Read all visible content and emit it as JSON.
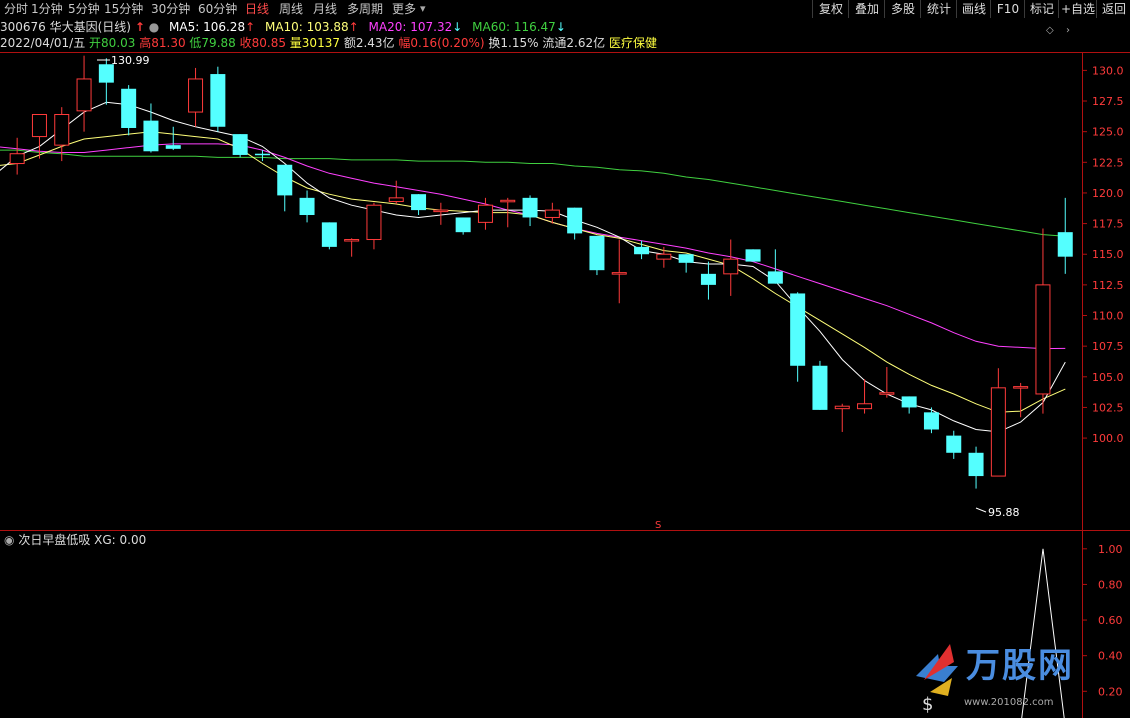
{
  "toolbar": {
    "tabs": [
      "分时",
      "1分钟",
      "5分钟",
      "15分钟",
      "30分钟",
      "60分钟",
      "日线",
      "周线",
      "月线",
      "多周期",
      "更多"
    ],
    "active_tab": "日线",
    "right_buttons": [
      "复权",
      "叠加",
      "多股",
      "统计",
      "画线",
      "F10",
      "标记",
      "+自选",
      "返回"
    ]
  },
  "stock": {
    "code_name": "300676 华大基因(日线)",
    "ma5": "MA5: 106.28",
    "ma10": "MA10: 103.88",
    "ma20": "MA20: 107.32",
    "ma60": "MA60: 116.47"
  },
  "quote": {
    "date": "2022/04/01/五",
    "open": "开80.03",
    "high": "高81.30",
    "low": "低79.88",
    "close": "收80.85",
    "volume": "量30137",
    "amount": "额2.43亿",
    "change": "幅0.16(0.20%)",
    "turnover": "换1.15%",
    "float": "流通2.62亿",
    "sector": "医疗保健"
  },
  "annotations": {
    "high_label": "130.99",
    "low_label": "95.88",
    "s_marker": "S"
  },
  "indicator": {
    "title": "次日早盘低吸  XG: 0.00"
  },
  "logo": {
    "text": "万股网",
    "url_text": "www.201082.com"
  },
  "colors": {
    "up": "#ff3b3b",
    "down": "#54ffff",
    "ma5": "#ffffff",
    "ma10": "#ffff7a",
    "ma20": "#ff40ff",
    "ma60": "#40d040",
    "axis": "#b01010",
    "sector": "#ffff40"
  },
  "chart_data": [
    {
      "type": "candlestick",
      "ylim": [
        92.5,
        131.5
      ],
      "y_ticks": [
        100.0,
        102.5,
        105.0,
        107.5,
        110.0,
        112.5,
        115.0,
        117.5,
        120.0,
        122.5,
        125.0,
        127.5,
        130.0
      ],
      "candles": [
        {
          "o": 122.4,
          "h": 124.5,
          "l": 121.5,
          "c": 123.2
        },
        {
          "o": 124.6,
          "h": 126.0,
          "l": 122.8,
          "c": 126.4
        },
        {
          "o": 123.9,
          "h": 127.0,
          "l": 122.6,
          "c": 126.4
        },
        {
          "o": 126.7,
          "h": 131.2,
          "l": 125.0,
          "c": 129.3
        },
        {
          "o": 130.5,
          "h": 130.99,
          "l": 127.2,
          "c": 129.0
        },
        {
          "o": 128.5,
          "h": 128.8,
          "l": 124.7,
          "c": 125.3
        },
        {
          "o": 125.9,
          "h": 127.3,
          "l": 123.3,
          "c": 123.4
        },
        {
          "o": 123.9,
          "h": 125.4,
          "l": 123.5,
          "c": 123.6
        },
        {
          "o": 126.6,
          "h": 130.2,
          "l": 125.4,
          "c": 129.3
        },
        {
          "o": 129.7,
          "h": 130.3,
          "l": 125.0,
          "c": 125.4
        },
        {
          "o": 124.8,
          "h": 124.8,
          "l": 122.9,
          "c": 123.1
        },
        {
          "o": 123.2,
          "h": 123.5,
          "l": 122.6,
          "c": 123.1
        },
        {
          "o": 122.3,
          "h": 122.3,
          "l": 118.5,
          "c": 119.8
        },
        {
          "o": 119.6,
          "h": 120.2,
          "l": 117.6,
          "c": 118.2
        },
        {
          "o": 117.6,
          "h": 117.6,
          "l": 115.4,
          "c": 115.6
        },
        {
          "o": 116.2,
          "h": 116.3,
          "l": 114.8,
          "c": 116.2
        },
        {
          "o": 116.2,
          "h": 119.2,
          "l": 115.4,
          "c": 119.0
        },
        {
          "o": 119.3,
          "h": 121.0,
          "l": 119.1,
          "c": 119.6
        },
        {
          "o": 119.9,
          "h": 119.9,
          "l": 118.2,
          "c": 118.6
        },
        {
          "o": 118.6,
          "h": 119.2,
          "l": 117.4,
          "c": 118.6
        },
        {
          "o": 118.0,
          "h": 118.0,
          "l": 116.6,
          "c": 116.8
        },
        {
          "o": 117.6,
          "h": 119.6,
          "l": 117.0,
          "c": 119.0
        },
        {
          "o": 119.3,
          "h": 119.6,
          "l": 117.2,
          "c": 119.4
        },
        {
          "o": 119.6,
          "h": 119.8,
          "l": 117.3,
          "c": 118.0
        },
        {
          "o": 118.0,
          "h": 119.2,
          "l": 117.5,
          "c": 118.6
        },
        {
          "o": 118.8,
          "h": 118.8,
          "l": 116.2,
          "c": 116.7
        },
        {
          "o": 116.5,
          "h": 116.5,
          "l": 113.3,
          "c": 113.7
        },
        {
          "o": 113.5,
          "h": 116.2,
          "l": 111.0,
          "c": 113.5
        },
        {
          "o": 115.6,
          "h": 116.1,
          "l": 114.6,
          "c": 115.0
        },
        {
          "o": 114.6,
          "h": 115.6,
          "l": 113.9,
          "c": 115.0
        },
        {
          "o": 115.0,
          "h": 115.0,
          "l": 113.5,
          "c": 114.3
        },
        {
          "o": 113.4,
          "h": 114.4,
          "l": 111.3,
          "c": 112.5
        },
        {
          "o": 113.4,
          "h": 116.2,
          "l": 111.6,
          "c": 114.6
        },
        {
          "o": 115.4,
          "h": 115.4,
          "l": 114.4,
          "c": 114.4
        },
        {
          "o": 113.6,
          "h": 115.4,
          "l": 112.6,
          "c": 112.6
        },
        {
          "o": 111.8,
          "h": 111.9,
          "l": 104.6,
          "c": 105.9
        },
        {
          "o": 105.9,
          "h": 106.3,
          "l": 102.3,
          "c": 102.3
        },
        {
          "o": 102.4,
          "h": 102.8,
          "l": 100.5,
          "c": 102.6
        },
        {
          "o": 102.4,
          "h": 104.8,
          "l": 102.0,
          "c": 102.8
        },
        {
          "o": 103.7,
          "h": 105.8,
          "l": 103.3,
          "c": 103.7
        },
        {
          "o": 103.4,
          "h": 103.4,
          "l": 102.0,
          "c": 102.5
        },
        {
          "o": 102.1,
          "h": 102.5,
          "l": 100.4,
          "c": 100.7
        },
        {
          "o": 100.2,
          "h": 100.6,
          "l": 98.3,
          "c": 98.8
        },
        {
          "o": 98.8,
          "h": 99.3,
          "l": 95.88,
          "c": 96.9
        },
        {
          "o": 96.9,
          "h": 105.7,
          "l": 96.9,
          "c": 104.1
        },
        {
          "o": 104.1,
          "h": 104.5,
          "l": 101.7,
          "c": 104.2
        },
        {
          "o": 103.6,
          "h": 117.1,
          "l": 102.0,
          "c": 112.5
        },
        {
          "o": 116.8,
          "h": 119.6,
          "l": 113.4,
          "c": 114.8
        }
      ],
      "ma5": [
        121.5,
        123.0,
        123.8,
        125.2,
        126.6,
        127.4,
        127.2,
        126.6,
        125.9,
        125.4,
        125.0,
        124.6,
        123.8,
        122.4,
        120.8,
        119.6,
        119.0,
        118.6,
        118.2,
        118.0,
        118.2,
        118.4,
        118.6,
        118.6,
        118.6,
        118.5,
        117.8,
        117.2,
        116.4,
        115.3,
        115.0,
        114.4,
        114.2,
        114.2,
        114.0,
        112.8,
        110.7,
        108.7,
        106.4,
        104.7,
        103.6,
        102.8,
        102.3,
        101.4,
        100.7,
        100.5,
        101.3,
        102.9,
        106.2
      ],
      "ma10": [
        122.4,
        122.2,
        122.4,
        123.1,
        123.8,
        124.4,
        124.6,
        124.8,
        125.0,
        124.8,
        124.6,
        124.4,
        123.6,
        122.4,
        121.3,
        120.4,
        119.9,
        119.5,
        119.3,
        119.1,
        118.8,
        118.6,
        118.5,
        118.4,
        118.4,
        118.2,
        117.6,
        117.1,
        116.6,
        116.3,
        115.8,
        115.3,
        115.1,
        114.6,
        114.1,
        113.0,
        111.8,
        110.7,
        109.6,
        108.5,
        107.4,
        106.2,
        105.2,
        104.3,
        103.6,
        102.8,
        102.1,
        102.2,
        103.2,
        104.0
      ],
      "ma20": [
        123.8,
        123.6,
        123.4,
        123.3,
        123.3,
        123.5,
        123.7,
        123.9,
        124.0,
        124.0,
        124.0,
        123.9,
        123.5,
        122.9,
        122.2,
        121.6,
        121.2,
        120.8,
        120.5,
        120.2,
        119.9,
        119.5,
        119.1,
        118.6,
        118.2,
        117.6,
        117.1,
        116.7,
        116.4,
        116.1,
        115.8,
        115.5,
        115.1,
        114.8,
        114.4,
        113.8,
        113.2,
        112.6,
        112.0,
        111.4,
        110.8,
        110.1,
        109.4,
        108.6,
        107.9,
        107.5,
        107.4,
        107.3,
        107.32
      ],
      "ma60": [
        123.5,
        123.5,
        123.3,
        123.2,
        123.0,
        123.0,
        123.0,
        123.0,
        123.0,
        123.0,
        122.9,
        122.9,
        122.9,
        122.8,
        122.8,
        122.8,
        122.7,
        122.7,
        122.7,
        122.6,
        122.6,
        122.6,
        122.5,
        122.5,
        122.4,
        122.4,
        122.2,
        122.1,
        121.9,
        121.8,
        121.6,
        121.3,
        121.1,
        120.8,
        120.5,
        120.2,
        119.9,
        119.6,
        119.3,
        119.0,
        118.7,
        118.4,
        118.1,
        117.8,
        117.5,
        117.2,
        116.9,
        116.6,
        116.47
      ]
    },
    {
      "type": "line",
      "title": "次日早盘低吸",
      "ylim": [
        0.05,
        1.1
      ],
      "y_ticks": [
        0.2,
        0.4,
        0.6,
        0.8,
        1.0
      ],
      "series": [
        {
          "name": "XG",
          "values": [
            0,
            0,
            0,
            0,
            0,
            0,
            0,
            0,
            0,
            0,
            0,
            0,
            0,
            0,
            0,
            0,
            0,
            0,
            0,
            0,
            0,
            0,
            0,
            0,
            0,
            0,
            0,
            0,
            0,
            0,
            0,
            0,
            0,
            0,
            0,
            0,
            0,
            0,
            0,
            0,
            0,
            0,
            0,
            0,
            0,
            0,
            1,
            0,
            0
          ]
        }
      ]
    }
  ]
}
